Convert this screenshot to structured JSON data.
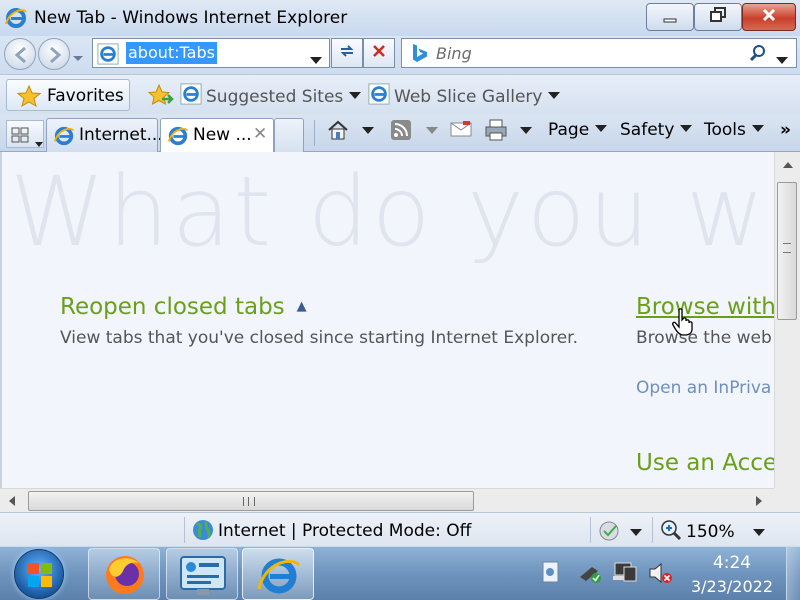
{
  "window": {
    "title": "New Tab - Windows Internet Explorer",
    "minimize_icon": "minimize-icon",
    "maximize_icon": "restore-icon",
    "close_icon": "close-icon"
  },
  "address_bar": {
    "url": "about:Tabs",
    "search_placeholder": "Bing"
  },
  "favorites_bar": {
    "favorites_label": "Favorites",
    "links": [
      {
        "label": "Suggested Sites"
      },
      {
        "label": "Web Slice Gallery"
      }
    ]
  },
  "tabs": [
    {
      "label": "Internet..."
    },
    {
      "label": "New ...",
      "close": "✕"
    }
  ],
  "command_bar": {
    "page_label": "Page",
    "safety_label": "Safety",
    "tools_label": "Tools",
    "more": "»"
  },
  "content": {
    "watermark": "What do you want to",
    "reopen_heading": "Reopen closed tabs",
    "reopen_desc": "View tabs that you've closed since starting Internet Explorer.",
    "browse_heading": "Browse with",
    "browse_desc": "Browse the web",
    "inprivate_link": "Open an InPriva",
    "accel_heading": "Use an Acce"
  },
  "status_bar": {
    "zone_text": "Internet | Protected Mode: Off",
    "zoom": "150%"
  },
  "taskbar": {
    "time": "4:24",
    "date": "3/23/2022"
  },
  "colors": {
    "heading_green": "#6aa019",
    "link_blue": "#6d8fc0",
    "selection_blue": "#3399ff"
  }
}
